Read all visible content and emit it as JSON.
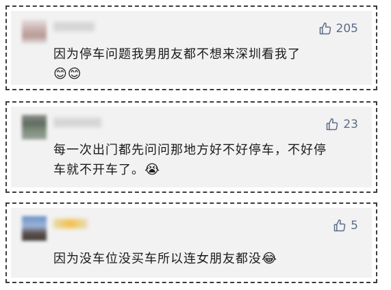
{
  "comments": [
    {
      "likes": "205",
      "text_line1": "因为停车问题我男朋友都不想来深圳看我了",
      "emoji": "😊😊"
    },
    {
      "likes": "23",
      "text_line1": "每一次出门都先问问那地方好不好停车，不好停",
      "text_line2": "车就不开车了。",
      "emoji": "😭"
    },
    {
      "likes": "5",
      "text_line1": "因为没车位没买车所以连女朋友都没",
      "emoji": "😂"
    }
  ],
  "colors": {
    "text": "#1a1a1a",
    "like": "#5b6b8a",
    "card_bg": "#f2f2f2"
  },
  "icons": [
    "thumbs-up-icon"
  ]
}
